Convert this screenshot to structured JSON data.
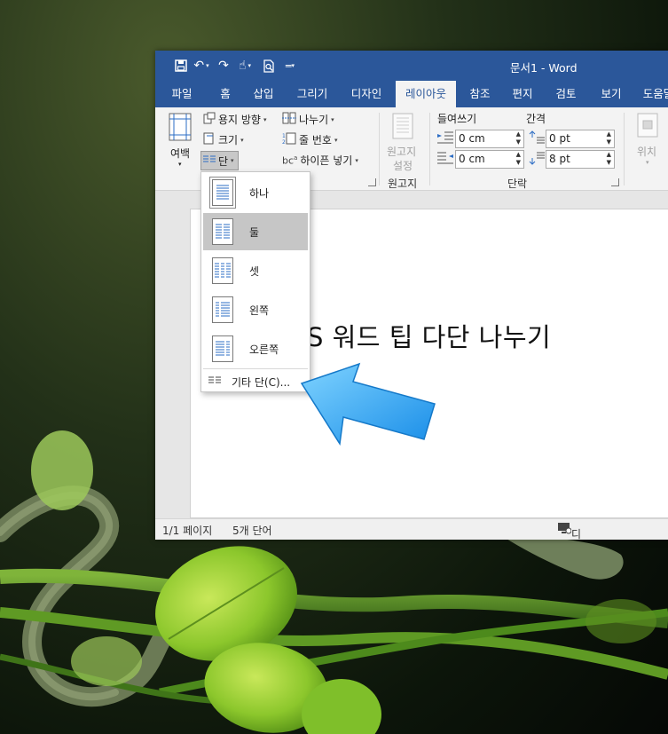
{
  "window": {
    "title": "문서1  -  Word"
  },
  "tabs": [
    "파일",
    "홈",
    "삽입",
    "그리기",
    "디자인",
    "레이아웃",
    "참조",
    "편지",
    "검토",
    "보기",
    "도움말"
  ],
  "active_tab": "레이아웃",
  "ribbon": {
    "margins": "여백",
    "orientation": "용지 방향",
    "size": "크기",
    "columns": "단",
    "breaks": "나누기",
    "line_numbers": "줄 번호",
    "hyphenation": "하이픈 넣기",
    "manuscript_line1": "원고지",
    "manuscript_line2": "설정",
    "manuscript_group": "원고지",
    "indent_label": "들여쓰기",
    "spacing_label": "간격",
    "indent_left": "0 cm",
    "indent_right": "0 cm",
    "spacing_before": "0 pt",
    "spacing_after": "8 pt",
    "paragraph_group": "단락",
    "position": "위치"
  },
  "columns_menu": {
    "items": [
      "하나",
      "둘",
      "셋",
      "왼쪽",
      "오른쪽"
    ],
    "more": "기타 단(C)..."
  },
  "document": {
    "text": "S 워드 팁 다단 나누기"
  },
  "status": {
    "page": "1/1 페이지",
    "words": "5개 단어",
    "display": "디스플레이 설정"
  }
}
